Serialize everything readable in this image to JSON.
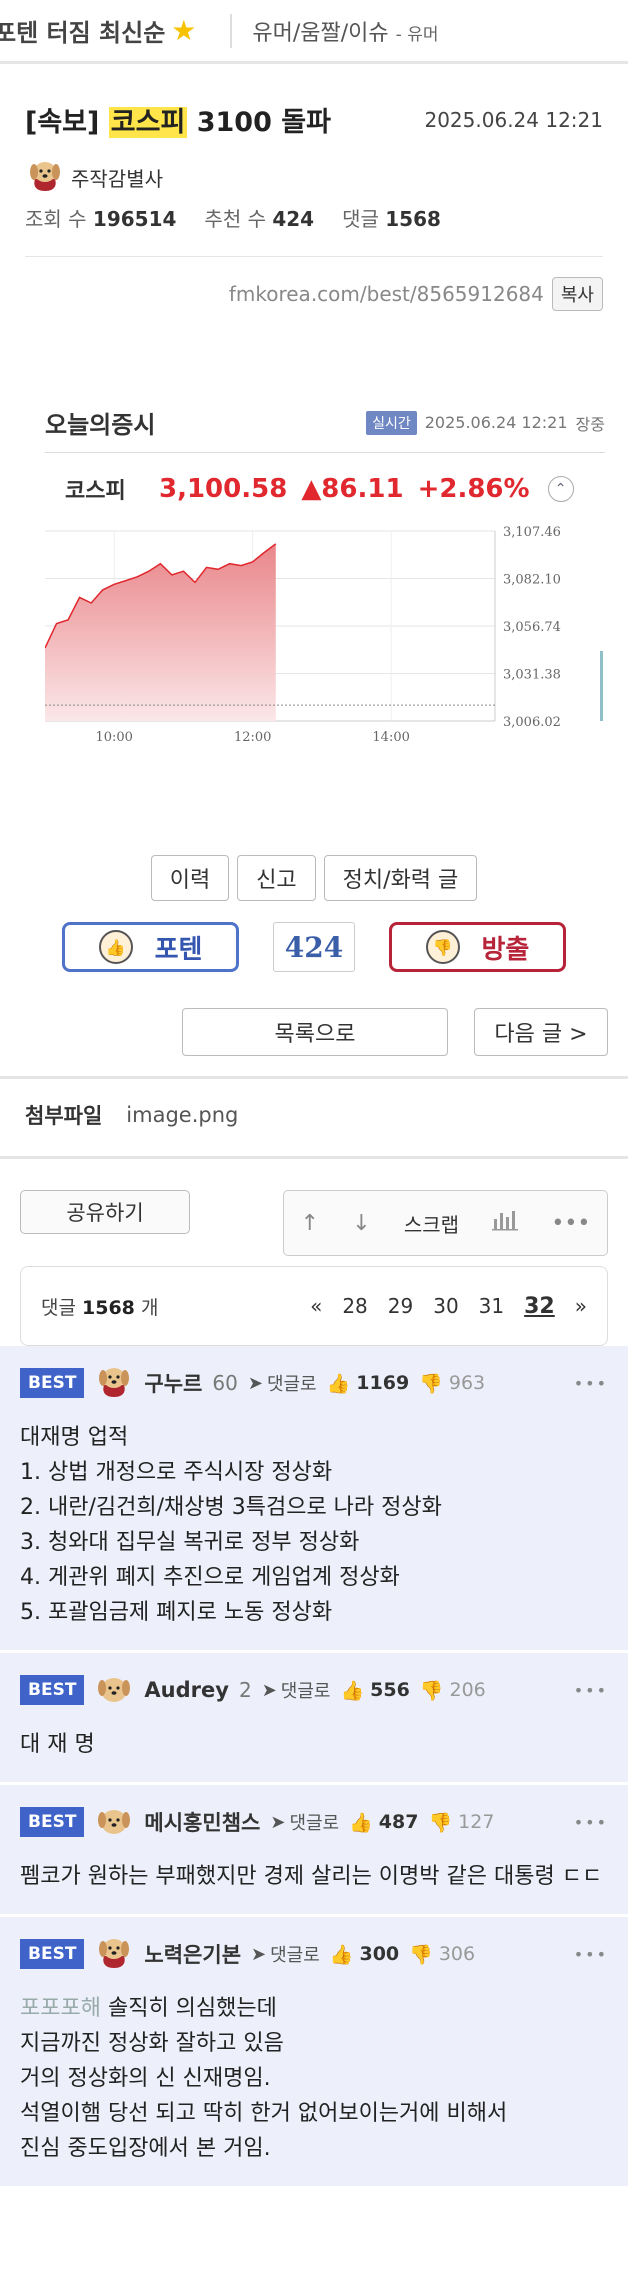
{
  "topbar": {
    "sort_label": "포텐 터짐 최신순",
    "star_icon": "star-icon",
    "category": "유머/움짤/이슈",
    "subcategory": "- 유머"
  },
  "article": {
    "title_prefix": "[속보]",
    "title_highlight": "코스피",
    "title_rest": "3100 돌파",
    "datetime": "2025.06.24 12:21",
    "author": "주작감별사",
    "views_label": "조회 수",
    "views": "196514",
    "recommend_label": "추천 수",
    "recommend": "424",
    "comments_label": "댓글",
    "comments": "1568",
    "url": "fmkorea.com/best/8565912684",
    "copy_label": "복사"
  },
  "stock": {
    "title": "오늘의증시",
    "live_label": "실시간",
    "datetime": "2025.06.24 12:21",
    "market_state": "장중",
    "index_name": "코스피",
    "price": "3,100.58",
    "change": "▲86.11",
    "change_pct": "+2.86%",
    "colors": {
      "up": "#e0282e",
      "area_top": "#e9868a",
      "area_bottom": "#fbe7e8"
    }
  },
  "chart_data": {
    "type": "area",
    "x_ticks": [
      "10:00",
      "12:00",
      "14:00"
    ],
    "y_ticks": [
      "3,107.46",
      "3,082.10",
      "3,056.74",
      "3,031.38",
      "3,006.02"
    ],
    "ylim": [
      3006.02,
      3107.46
    ],
    "x_start": "09:00",
    "x_end": "15:30",
    "x": [
      "09:00",
      "09:10",
      "09:20",
      "09:30",
      "09:40",
      "09:50",
      "10:00",
      "10:10",
      "10:20",
      "10:30",
      "10:40",
      "10:50",
      "11:00",
      "11:10",
      "11:20",
      "11:30",
      "11:40",
      "11:50",
      "12:00",
      "12:10",
      "12:20"
    ],
    "values": [
      3045,
      3058,
      3060,
      3072,
      3069,
      3076,
      3079,
      3081,
      3083,
      3086,
      3090,
      3084,
      3086,
      3080,
      3088,
      3087,
      3090,
      3089,
      3091,
      3096,
      3100.58
    ],
    "baseline": 3014.47
  },
  "actions": {
    "history": "이력",
    "report": "신고",
    "political": "정치/화력 글",
    "vote_up": "포텐",
    "vote_count": "424",
    "vote_down": "방출",
    "list": "목록으로",
    "next": "다음 글 >"
  },
  "attachments": {
    "label": "첨부파일",
    "file": "image.png"
  },
  "share": {
    "share_label": "공유하기",
    "scrap_label": "스크랩"
  },
  "pager": {
    "count_prefix": "댓글",
    "count": "1568",
    "count_suffix": "개",
    "first": "«",
    "pages": [
      "28",
      "29",
      "30",
      "31"
    ],
    "current": "32",
    "next": "»"
  },
  "comments": [
    {
      "badge": "BEST",
      "nick": "구누르",
      "level": "60",
      "reply": "댓글로",
      "up": "1169",
      "down": "963",
      "body": "대재명 업적\n1. 상법 개정으로 주식시장 정상화\n2. 내란/김건희/채상병 3특검으로 나라 정상화\n3. 청와대 집무실 복귀로 정부 정상화\n4. 게관위 폐지 추진으로 게임업계 정상화\n5. 포괄임금제 폐지로 노동 정상화"
    },
    {
      "badge": "BEST",
      "nick": "Audrey",
      "level": "2",
      "reply": "댓글로",
      "up": "556",
      "down": "206",
      "body": "대 재 명"
    },
    {
      "badge": "BEST",
      "nick": "메시홍민챔스",
      "level": "",
      "reply": "댓글로",
      "up": "487",
      "down": "127",
      "body": "펨코가 원하는 부패했지만 경제 살리는 이명박 같은 대통령 ㄷㄷ"
    },
    {
      "badge": "BEST",
      "nick": "노력은기본",
      "level": "",
      "reply": "댓글로",
      "up": "300",
      "down": "306",
      "body_muted": "포포포해",
      "body": " 솔직히 의심했는데\n지금까진 정상화 잘하고 있음\n거의 정상화의 신 신재명임.\n석열이햄 당선 되고 딱히 한거 없어보이는거에 비해서\n진심 중도입장에서 본 거임."
    }
  ]
}
